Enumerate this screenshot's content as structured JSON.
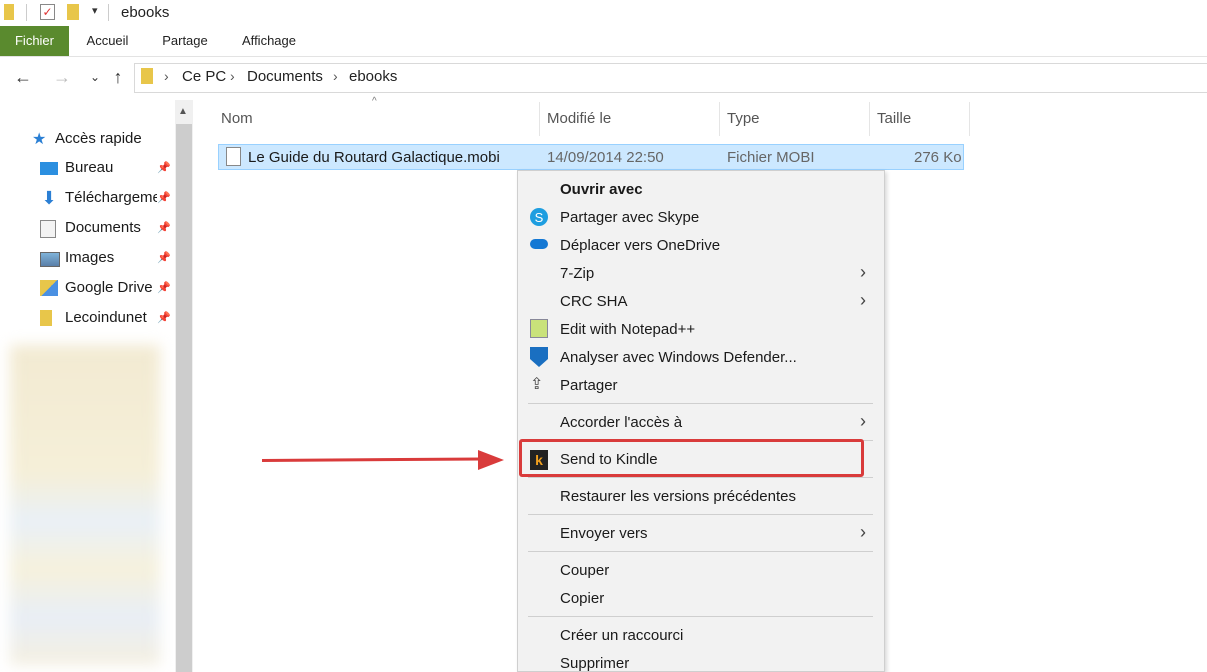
{
  "window": {
    "title": "ebooks"
  },
  "ribbon": {
    "tabs": [
      "Fichier",
      "Accueil",
      "Partage",
      "Affichage"
    ]
  },
  "address": {
    "crumbs": [
      "Ce PC",
      "Documents",
      "ebooks"
    ]
  },
  "nav": {
    "quick_access": "Accès rapide",
    "items": [
      {
        "label": "Bureau",
        "icon": "desktop-icon"
      },
      {
        "label": "Téléchargements",
        "icon": "download-icon"
      },
      {
        "label": "Documents",
        "icon": "documents-icon"
      },
      {
        "label": "Images",
        "icon": "images-icon"
      },
      {
        "label": "Google Drive",
        "icon": "google-drive-icon"
      },
      {
        "label": "Lecoindunet",
        "icon": "folder-icon"
      }
    ]
  },
  "columns": {
    "name": "Nom",
    "modified": "Modifié le",
    "type": "Type",
    "size": "Taille"
  },
  "file": {
    "name": "Le Guide du Routard Galactique.mobi",
    "modified": "14/09/2014 22:50",
    "type": "Fichier MOBI",
    "size": "276 Ko"
  },
  "menu": {
    "open_with": "Ouvrir avec",
    "skype": "Partager avec Skype",
    "onedrive": "Déplacer vers OneDrive",
    "zip": "7-Zip",
    "crc": "CRC SHA",
    "notepad": "Edit with Notepad++",
    "defender": "Analyser avec Windows Defender...",
    "share": "Partager",
    "grant": "Accorder l'accès à",
    "kindle": "Send to Kindle",
    "restore": "Restaurer les versions précédentes",
    "sendto": "Envoyer vers",
    "cut": "Couper",
    "copy": "Copier",
    "shortcut": "Créer un raccourci",
    "delete": "Supprimer"
  },
  "colors": {
    "accent": "#5a8a2e",
    "selection": "#cce8ff",
    "highlight": "#d93b3b"
  }
}
